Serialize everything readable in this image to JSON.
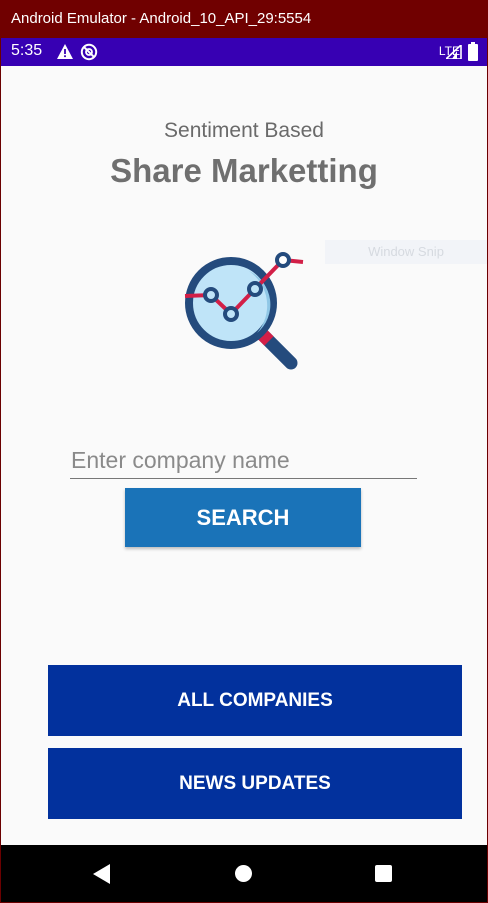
{
  "window": {
    "title": "Android Emulator - Android_10_API_29:5554"
  },
  "status_bar": {
    "time": "5:35",
    "network": "LTE",
    "colors": {
      "background": "#3700b3"
    }
  },
  "main": {
    "subtitle": "Sentiment Based",
    "title": "Share Marketting",
    "overlay_label": "Window Snip",
    "search": {
      "placeholder": "Enter company name",
      "value": "",
      "button_label": "SEARCH"
    },
    "buttons": {
      "all_companies": "ALL COMPANIES",
      "news_updates": "NEWS UPDATES"
    }
  },
  "icons": {
    "status": [
      "warning-icon",
      "no-data-icon",
      "signal-icon",
      "battery-icon"
    ],
    "logo": "magnifier-chart-icon",
    "nav": [
      "back-icon",
      "home-icon",
      "recents-icon"
    ]
  },
  "colors": {
    "primary_button": "#1a73b8",
    "secondary_button": "#02319d",
    "title_bar": "#700000"
  }
}
